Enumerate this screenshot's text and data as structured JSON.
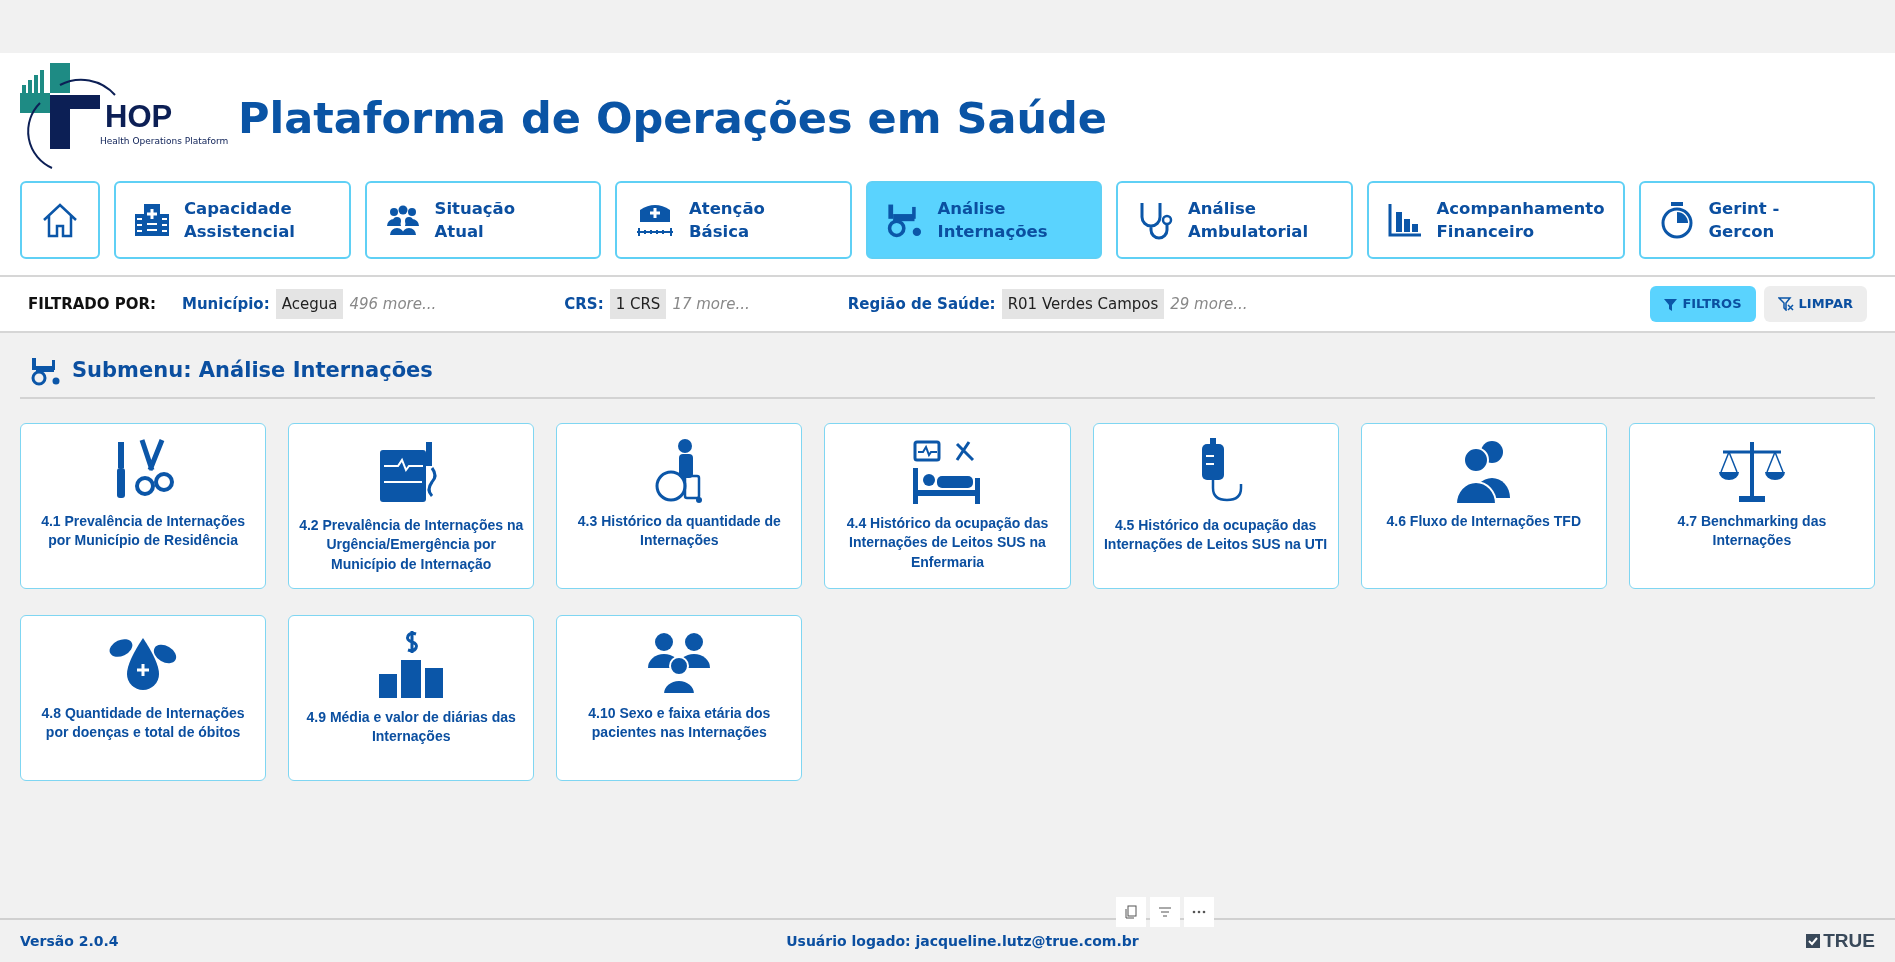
{
  "logo": {
    "name": "HOP",
    "tagline": "Health Operations Plataform"
  },
  "title": "Plataforma de Operações em Saúde",
  "nav": [
    {
      "kind": "home",
      "selected": false
    },
    {
      "kind": "item",
      "lines": [
        "Capacidade",
        "Assistencial"
      ],
      "selected": false
    },
    {
      "kind": "item",
      "lines": [
        "Situação",
        "Atual"
      ],
      "selected": false
    },
    {
      "kind": "item",
      "lines": [
        "Atenção",
        "Básica"
      ],
      "selected": false
    },
    {
      "kind": "item",
      "lines": [
        "Análise",
        "Internações"
      ],
      "selected": true
    },
    {
      "kind": "item",
      "lines": [
        "Análise",
        "Ambulatorial"
      ],
      "selected": false
    },
    {
      "kind": "item",
      "lines": [
        "Acompanhamento",
        "Financeiro"
      ],
      "selected": false
    },
    {
      "kind": "item",
      "lines": [
        "Gerint -",
        "Gercon"
      ],
      "selected": false
    }
  ],
  "filter_bar": {
    "label": "FILTRADO POR:",
    "filters": [
      {
        "label": "Município:",
        "value": "Acegua",
        "more": "496 more..."
      },
      {
        "label": "CRS:",
        "value": "1 CRS",
        "more": "17 more..."
      },
      {
        "label": "Região de Saúde:",
        "value": "R01 Verdes Campos",
        "more": "29 more..."
      }
    ],
    "buttons": [
      {
        "label": "FILTROS",
        "primary": true
      },
      {
        "label": "LIMPAR",
        "primary": false
      }
    ]
  },
  "submenu_title": "Submenu: Análise Internações",
  "cards": [
    {
      "label": "4.1 Prevalência de Internações por Município de Residência"
    },
    {
      "label": "4.2 Prevalência de Internações na Urgência/Emergência por Município de Internação"
    },
    {
      "label": "4.3 Histórico da quantidade de Internações"
    },
    {
      "label": "4.4 Histórico da ocupação das Internações de Leitos SUS na Enfermaria"
    },
    {
      "label": "4.5 Histórico da ocupação das Internações de Leitos SUS na UTI"
    },
    {
      "label": "4.6 Fluxo de Internações TFD"
    },
    {
      "label": "4.7 Benchmarking das Internações"
    },
    {
      "label": "4.8 Quantidade de Internações por doenças e total de óbitos"
    },
    {
      "label": "4.9 Média e valor de diárias das Internações"
    },
    {
      "label": "4.10 Sexo e faixa etária dos pacientes nas Internações"
    }
  ],
  "footer": {
    "version": "Versão 2.0.4",
    "user": "Usuário logado: jacqueline.lutz@true.com.br",
    "brand": "TRUE"
  }
}
